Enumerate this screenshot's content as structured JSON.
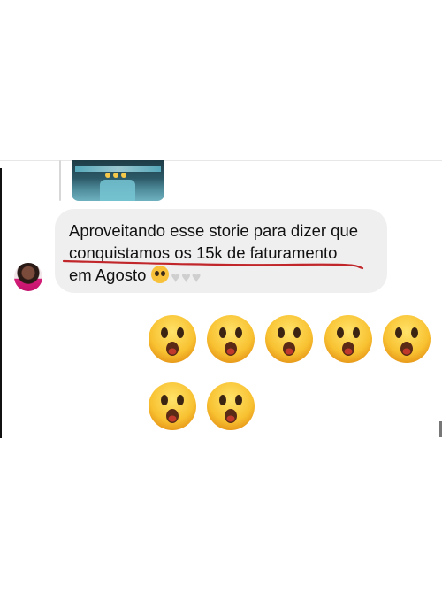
{
  "message": {
    "lines": [
      "Aproveitando esse storie para dizer que",
      "conquistamos os 15k de faturamento",
      "em Agosto"
    ],
    "inline_emoji": "pleading-face-icon",
    "hearts_count": 3
  },
  "reactions": {
    "emoji": "astonished-face-icon",
    "count": 7
  },
  "annotation": {
    "underline_color": "#c0262a"
  }
}
